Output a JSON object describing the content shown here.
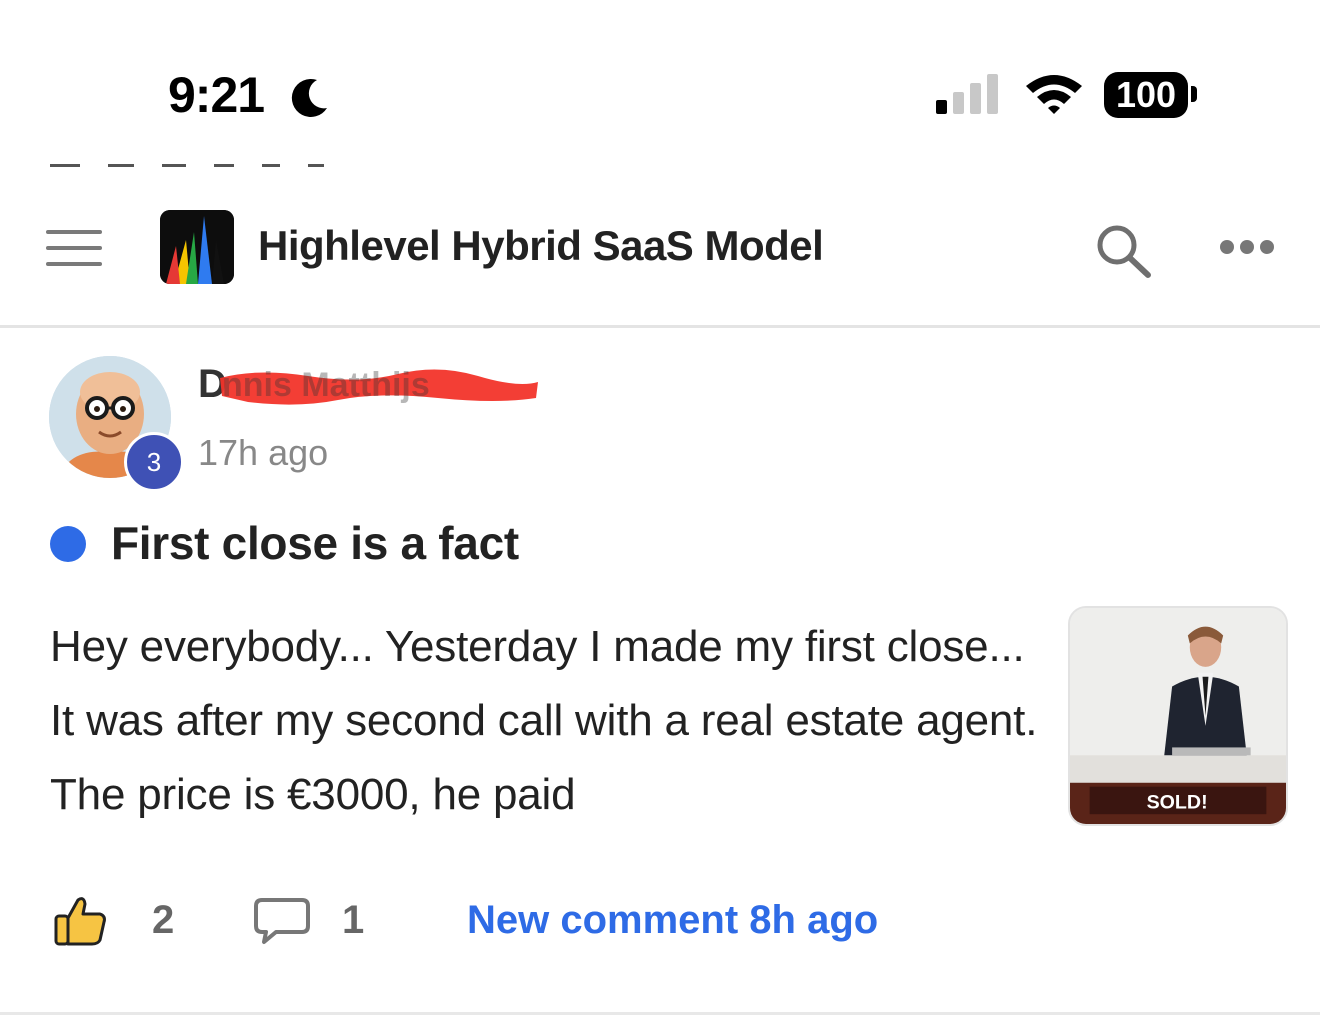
{
  "status_bar": {
    "time": "9:21",
    "battery": "100"
  },
  "header": {
    "title": "Highlevel Hybrid SaaS Model"
  },
  "post": {
    "author_visible": "D",
    "author_redacted_overlay": "nnis Matthijs",
    "level": "3",
    "timestamp": "17h ago",
    "title": "First close is a fact",
    "body": "Hey everybody... Yesterday I made my first close... It was after my second call with a real estate agent. The price is €3000, he paid",
    "thumbnail_caption": "SOLD!",
    "likes": "2",
    "comments": "1",
    "new_comment": "New comment 8h ago"
  },
  "colors": {
    "accent_blue": "#2e6be6",
    "level_badge": "#3f51b5",
    "redaction_red": "#f2342a"
  },
  "icons": [
    "moon-icon",
    "signal-icon",
    "wifi-icon",
    "battery-icon",
    "menu-icon",
    "app-logo-icon",
    "search-icon",
    "more-icon",
    "thumbs-up-icon",
    "comment-icon"
  ]
}
